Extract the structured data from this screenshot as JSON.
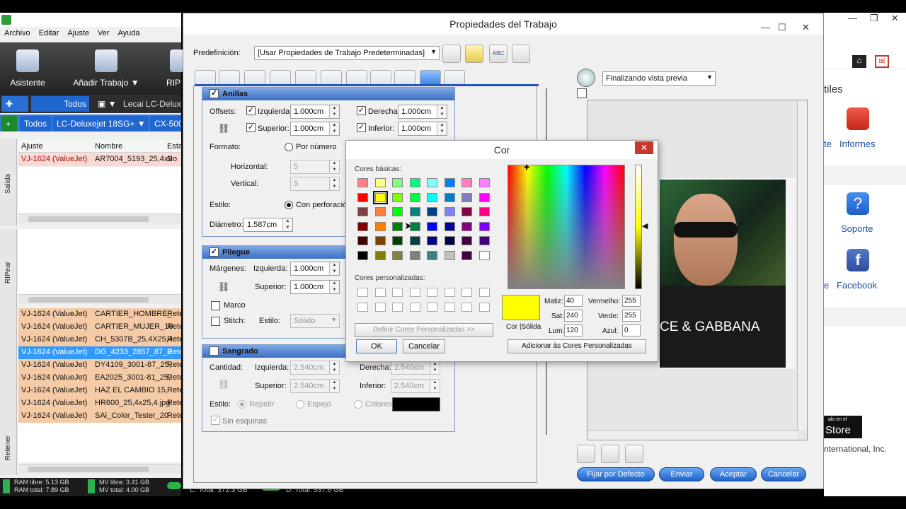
{
  "left_app": {
    "menu": [
      "Archivo",
      "Editar",
      "Ajuste",
      "Ver",
      "Ayuda"
    ],
    "toolbar": {
      "asistente": "Asistente",
      "anadir": "Añadir Trabajo",
      "rip": "RIP"
    },
    "tabs1": {
      "todos": "Todos",
      "printer": "Lecai LC-Delux"
    },
    "tabs2": {
      "todos": "Todos",
      "printer": "LC-Deluxejet 18SG+",
      "cx": "CX-500"
    },
    "side_labels": {
      "salida": "Salida",
      "ripear": "RIPear",
      "retener": "Retener"
    },
    "grid1": {
      "headers": [
        "Ajuste",
        "Nombre",
        "Esta"
      ],
      "rows": [
        [
          "VJ-1624 (ValueJet)",
          "AR7004_5193_25,4x2",
          "No"
        ]
      ]
    },
    "grid3": {
      "rows": [
        [
          "VJ-1624 (ValueJet)",
          "CARTIER_HOMBRE_",
          "Rete"
        ],
        [
          "VJ-1624 (ValueJet)",
          "CARTIER_MUJER_10",
          "Rete"
        ],
        [
          "VJ-1624 (ValueJet)",
          "CH_5307B_25,4X25,4",
          "Rete"
        ],
        [
          "VJ-1624 (ValueJet)",
          "DG_4233_2857_87_2",
          "Rete"
        ],
        [
          "VJ-1624 (ValueJet)",
          "DY4109_3001-87_25,",
          "Rete"
        ],
        [
          "VJ-1624 (ValueJet)",
          "EA2025_3001-81_25,",
          "Rete"
        ],
        [
          "VJ-1624 (ValueJet)",
          "HAZ EL CAMBIO 15,",
          "Rete"
        ],
        [
          "VJ-1624 (ValueJet)",
          "HR600_25,4x25,4.jpg",
          "Rete"
        ],
        [
          "VJ-1624 (ValueJet)",
          "SAi_Color_Tester_20",
          "Rete"
        ]
      ]
    },
    "status": {
      "ram_libre": "RAM libre: 5.13 GB",
      "ram_total": "RAM total: 7.89 GB",
      "mv_libre": "MV libre: 3.41 GB",
      "mv_total": "MV total: 4.00 GB",
      "c_total": "C: Total: 372.3 GB",
      "d_total": "D: Total: 537.6 GB"
    }
  },
  "dialog": {
    "title": "Propiedades del Trabajo",
    "predef_label": "Predefinición:",
    "predef_value": "[Usar Propiedades de Trabajo Predeterminadas]",
    "anillas": {
      "title": "Anillas",
      "offsets": "Offsets:",
      "izquierda": "Izquierda:",
      "izq_val": "1.000cm",
      "derecha": "Derecha:",
      "der_val": "1.000cm",
      "superior": "Superior:",
      "sup_val": "1.000cm",
      "inferior": "Inferior:",
      "inf_val": "1.000cm",
      "formato": "Formato:",
      "por_numero": "Por número",
      "horizontal": "Horizontal:",
      "h_val": "5",
      "vertical": "Vertical:",
      "v_val": "5",
      "estilo": "Estilo:",
      "con_perforacion": "Con perforación",
      "diametro": "Diámetro:",
      "diam_val": "1.587cm"
    },
    "pliegue": {
      "title": "Pliegue",
      "margenes": "Márgenes:",
      "izquierda": "Izquierda:",
      "izq_val": "1.000cm",
      "superior": "Superior:",
      "sup_val": "1.000cm",
      "marco": "Marco",
      "stitch": "Stitch:",
      "estilo": "Estilo:",
      "estilo_val": "Sólido"
    },
    "sangrado": {
      "title": "Sangrado",
      "cantidad": "Cantidad:",
      "izquierda": "Izquierda:",
      "izq_val": "2.540cm",
      "derecha": "Derecha:",
      "der_val": "2.540cm",
      "superior": "Superior:",
      "sup_val": "2.540cm",
      "inferior": "Inferior:",
      "inf_val": "2.540cm",
      "estilo": "Estilo:",
      "repetir": "Repetir",
      "espejo": "Espejo",
      "colores": "Colores:",
      "sin_esquinas": "Sin esquinas"
    },
    "preview_combo": "Finalizando vista previa",
    "buttons": {
      "fijar": "Fijar por Defecto",
      "enviar": "Enviar",
      "aceptar": "Aceptar",
      "cancelar": "Cancelar"
    }
  },
  "cor": {
    "title": "Cor",
    "basic_label": "Cores básicas:",
    "custom_label": "Cores personalizadas:",
    "define_btn": "Definir Cores Personalizadas >>",
    "ok": "OK",
    "cancel": "Cancelar",
    "add_btn": "Adicionar às Cores Personalizadas",
    "cor_solida": "Cor |Sólida",
    "matiz_l": "Matiz:",
    "matiz": "40",
    "sat_l": "Sat:",
    "sat": "240",
    "lum_l": "Lum:",
    "lum": "120",
    "verm_l": "Vermelho:",
    "verm": "255",
    "verde_l": "Verde:",
    "verde": "255",
    "azul_l": "Azul:",
    "azul": "0",
    "swatches": [
      [
        "#ff8080",
        "#ffff80",
        "#80ff80",
        "#00ff80",
        "#80ffff",
        "#0080ff",
        "#ff80c0",
        "#ff80ff"
      ],
      [
        "#ff0000",
        "#ffff00",
        "#80ff00",
        "#00ff40",
        "#00ffff",
        "#0080c0",
        "#8080c0",
        "#ff00ff"
      ],
      [
        "#804040",
        "#ff8040",
        "#00ff00",
        "#008080",
        "#004080",
        "#8080ff",
        "#800040",
        "#ff0080"
      ],
      [
        "#800000",
        "#ff8000",
        "#008000",
        "#008040",
        "#0000ff",
        "#0000a0",
        "#800080",
        "#8000ff"
      ],
      [
        "#400000",
        "#804000",
        "#004000",
        "#004040",
        "#000080",
        "#000040",
        "#400040",
        "#400080"
      ],
      [
        "#000000",
        "#808000",
        "#808040",
        "#808080",
        "#408080",
        "#c0c0c0",
        "#400040",
        "#ffffff"
      ]
    ],
    "selected_color": "#ffff00"
  },
  "right": {
    "tiles": "tiles",
    "te": "te",
    "informes": "Informes",
    "soporte": "Soporte",
    "e": "e",
    "facebook": "Facebook",
    "store_small": "alo en el",
    "store": "Store",
    "intl": "nternational, Inc."
  },
  "preview_text": "CE & GABBANA"
}
